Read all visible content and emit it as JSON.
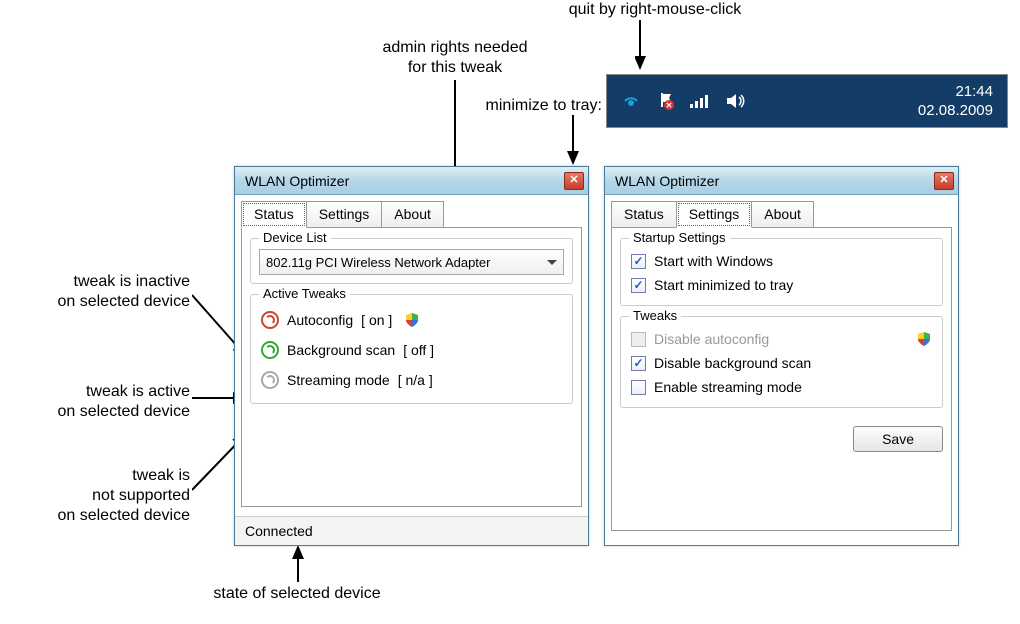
{
  "annotations": {
    "quit": "quit by right-mouse-click",
    "admin": "admin rights needed\nfor this tweak",
    "minimize": "minimize to tray:",
    "inactive": "tweak is inactive\non selected device",
    "active": "tweak is active\non selected device",
    "unsupported": "tweak is\nnot supported\non selected device",
    "state": "state of selected device"
  },
  "tray": {
    "time": "21:44",
    "date": "02.08.2009"
  },
  "window1": {
    "title": "WLAN Optimizer",
    "tabs": [
      "Status",
      "Settings",
      "About"
    ],
    "active_tab": 0,
    "device_list_legend": "Device List",
    "device_selected": "802.11g PCI Wireless Network Adapter",
    "active_tweaks_legend": "Active Tweaks",
    "tweaks": [
      {
        "name": "Autoconfig",
        "state": "[ on ]",
        "icon": "red",
        "shield": true
      },
      {
        "name": "Background scan",
        "state": "[ off ]",
        "icon": "green",
        "shield": false
      },
      {
        "name": "Streaming mode",
        "state": "[ n/a ]",
        "icon": "grey",
        "shield": false
      }
    ],
    "status": "Connected"
  },
  "window2": {
    "title": "WLAN Optimizer",
    "tabs": [
      "Status",
      "Settings",
      "About"
    ],
    "active_tab": 1,
    "startup_legend": "Startup Settings",
    "startup": [
      {
        "label": "Start with Windows",
        "checked": true,
        "disabled": false
      },
      {
        "label": "Start minimized to tray",
        "checked": true,
        "disabled": false
      }
    ],
    "tweaks_legend": "Tweaks",
    "tweaks": [
      {
        "label": "Disable autoconfig",
        "checked": false,
        "disabled": true,
        "shield": true
      },
      {
        "label": "Disable background scan",
        "checked": true,
        "disabled": false,
        "shield": false
      },
      {
        "label": "Enable streaming mode",
        "checked": false,
        "disabled": false,
        "shield": false
      }
    ],
    "save": "Save"
  }
}
